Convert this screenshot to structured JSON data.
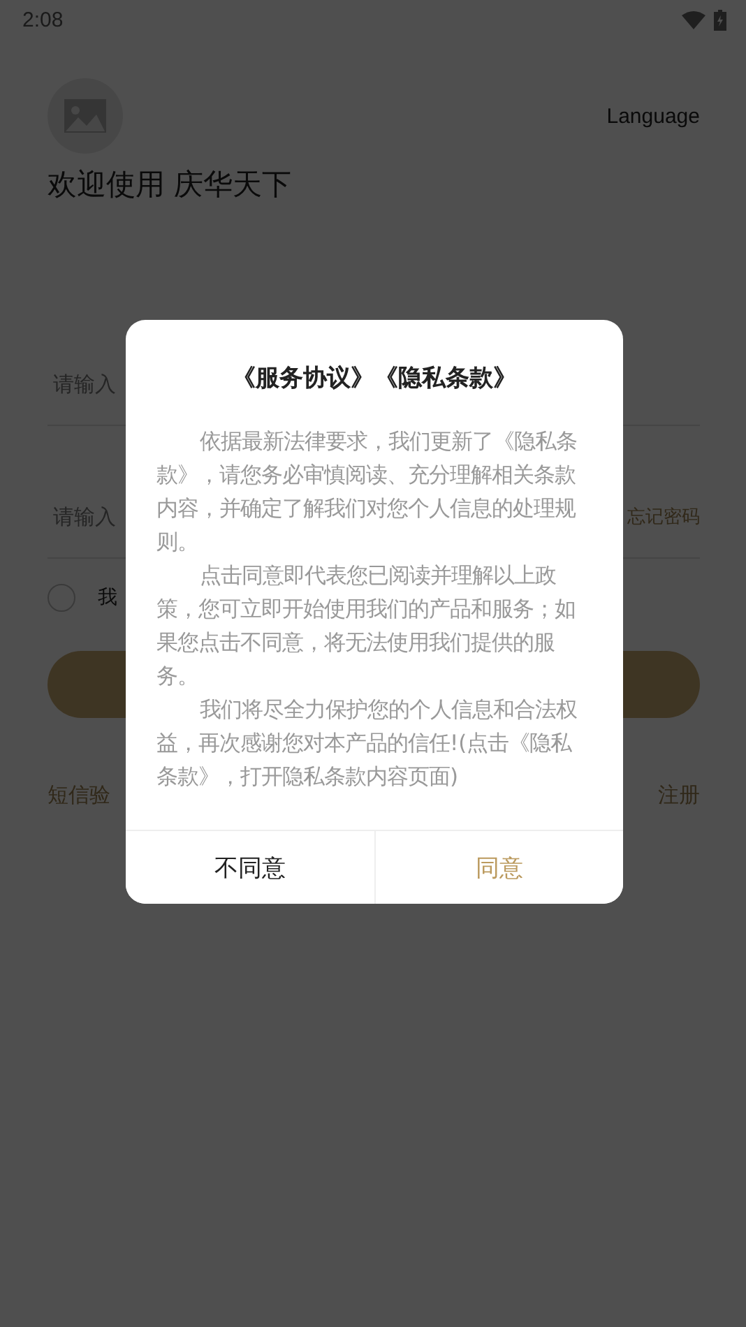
{
  "status_bar": {
    "time": "2:08"
  },
  "header": {
    "language": "Language",
    "welcome": "欢迎使用 庆华天下"
  },
  "phone_field": {
    "placeholder": "请输入"
  },
  "password_field": {
    "placeholder": "请输入",
    "forgot": "忘记密码"
  },
  "agreement": {
    "checked": false,
    "text": "我"
  },
  "links": {
    "sms_login": "短信验",
    "register": "注册"
  },
  "dialog": {
    "title": "《服务协议》《隐私条款》",
    "paragraphs": [
      "依据最新法律要求，我们更新了《隐私条款》，请您务必审慎阅读、充分理解相关条款内容，并确定了解我们对您个人信息的处理规则。",
      "点击同意即代表您已阅读并理解以上政策，您可立即开始使用我们的产品和服务；如果您点击不同意，将无法使用我们提供的服务。",
      "我们将尽全力保护您的个人信息和合法权益，再次感谢您对本产品的信任!(点击《隐私条款》，打开隐私条款内容页面)"
    ],
    "buttons": [
      {
        "label": "不同意",
        "kind": "decline"
      },
      {
        "label": "同意",
        "kind": "accept"
      }
    ]
  }
}
